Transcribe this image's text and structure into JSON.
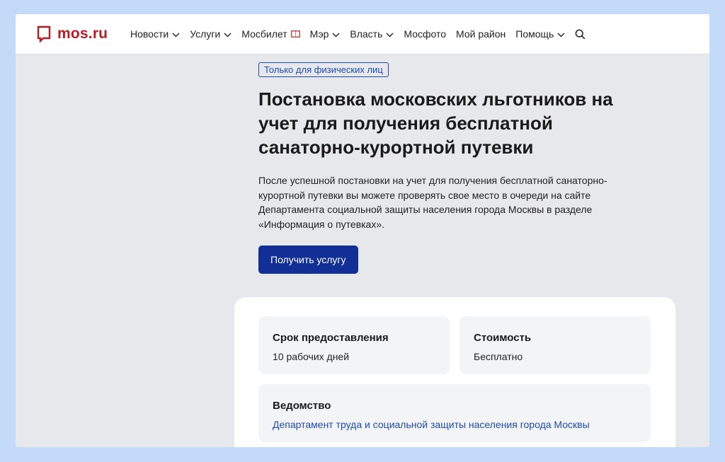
{
  "header": {
    "logo_text": "mos.ru",
    "nav": [
      {
        "label": "Новости",
        "dropdown": true
      },
      {
        "label": "Услуги",
        "dropdown": true
      },
      {
        "label": "Мосбилет",
        "dropdown": false,
        "icon": "ticket-icon"
      },
      {
        "label": "Мэр",
        "dropdown": true
      },
      {
        "label": "Власть",
        "dropdown": true
      },
      {
        "label": "Мосфото",
        "dropdown": false
      },
      {
        "label": "Мой район",
        "dropdown": false
      },
      {
        "label": "Помощь",
        "dropdown": true
      }
    ],
    "search_icon": "search-icon"
  },
  "main": {
    "badge": "Только для физических лиц",
    "title": "Постановка московских льготников на учет для получения бесплатной санаторно-курортной путевки",
    "description": "После успешной постановки на учет для получения бесплатной санаторно-курортной путевки вы можете проверять свое место в очереди на сайте Департамента социальной защиты населения города Москвы в разделе «Информация о путевках».",
    "cta_label": "Получить услугу"
  },
  "info": {
    "term": {
      "title": "Срок предоставления",
      "value": "10 рабочих дней"
    },
    "cost": {
      "title": "Стоимость",
      "value": "Бесплатно"
    },
    "agency": {
      "title": "Ведомство",
      "value": "Департамент труда и социальной защиты населения города Москвы"
    }
  },
  "colors": {
    "brand_red": "#b71c22",
    "accent_blue": "#112f94",
    "link_blue": "#1d4bb0",
    "page_bg": "#e7e8ec",
    "frame_bg": "#c3daf9"
  }
}
